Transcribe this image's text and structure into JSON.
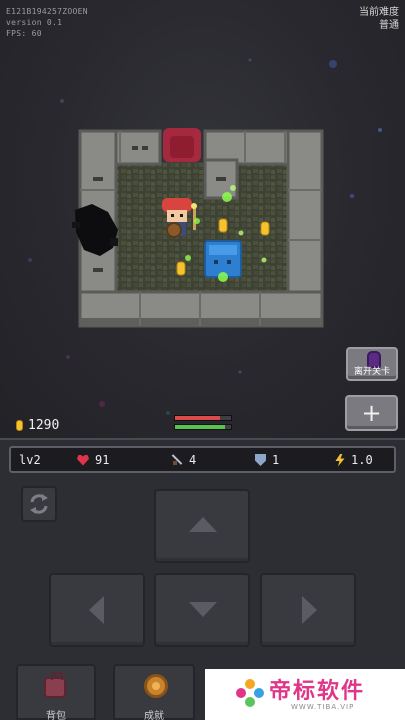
{
  "debug": {
    "build_id": "E121B194257ZOOEN",
    "version": "version 0.1",
    "fps": "FPS: 60"
  },
  "difficulty": {
    "label": "当前难度",
    "value": "普通"
  },
  "hud": {
    "gold": "1290",
    "health_fraction": 0.8,
    "energy_fraction": 0.9
  },
  "side_buttons": {
    "leave_level": "离开关卡",
    "add": "+"
  },
  "stats": {
    "level": "lv2",
    "hp": "91",
    "attack": "4",
    "defense": "1",
    "speed": "1.0"
  },
  "menu": {
    "backpack": "背包",
    "achievements": "成就"
  },
  "watermark": {
    "brand": "帝标软件",
    "url": "WWW.TIBA.VIP"
  },
  "colors": {
    "health_bar": "#d94b4b",
    "energy_bar": "#57c24f",
    "accent_gold": "#f4c430",
    "watermark_pink": "#e0368a"
  }
}
